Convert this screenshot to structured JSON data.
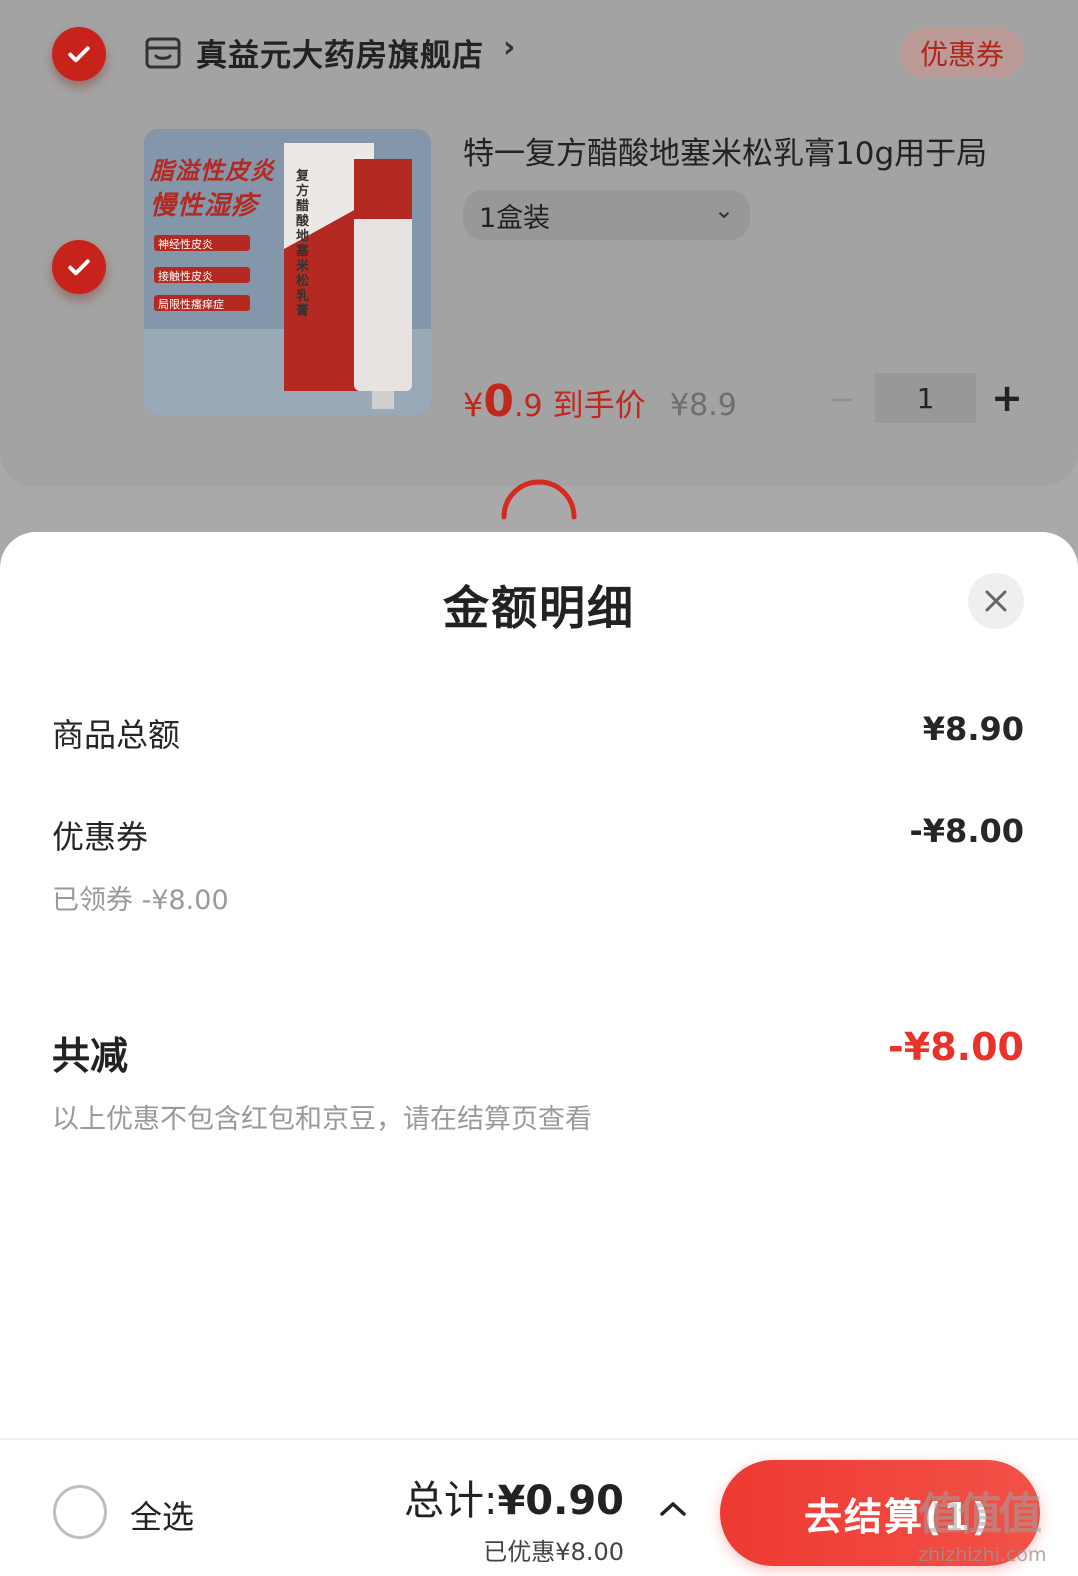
{
  "store": {
    "name": "真益元大药房旗舰店",
    "chevron": "›",
    "coupon_label": "优惠券"
  },
  "product": {
    "title": "特一复方醋酸地塞米松乳膏10g用于局",
    "spec": "1盒装",
    "spec_chevron": "⌄",
    "price_currency": "¥",
    "price_int": "0",
    "price_dec": ".9",
    "price_label": "到手价",
    "original_price": "¥8.9",
    "qty_minus": "−",
    "quantity": "1",
    "qty_plus": "+",
    "image_text": {
      "headline1": "脂溢性皮炎",
      "headline2": "慢性湿疹",
      "tag1": "神经性皮炎",
      "tag2": "接触性皮炎",
      "tag3": "局限性瘙痒症",
      "box_name": "复方醋酸地塞米松乳膏"
    }
  },
  "sheet": {
    "title": "金额明细",
    "rows": [
      {
        "label": "商品总额",
        "value": "¥8.90"
      },
      {
        "label": "优惠券",
        "value": "-¥8.00"
      }
    ],
    "coupon_note": "已领券 -¥8.00",
    "total_label": "共减",
    "total_value": "-¥8.00",
    "disclaimer": "以上优惠不包含红包和京豆，请在结算页查看"
  },
  "bottom": {
    "select_all": "全选",
    "sum_prefix": "总计:",
    "sum_amount": "¥0.90",
    "saved": "已优惠¥8.00",
    "checkout": "去结算(1)"
  },
  "watermark": {
    "glyph": "值值值",
    "url": "zhizhizhi.com"
  },
  "colors": {
    "accent": "#e8322a",
    "checked": "#c8231b",
    "muted_text": "#9a9a9a"
  }
}
